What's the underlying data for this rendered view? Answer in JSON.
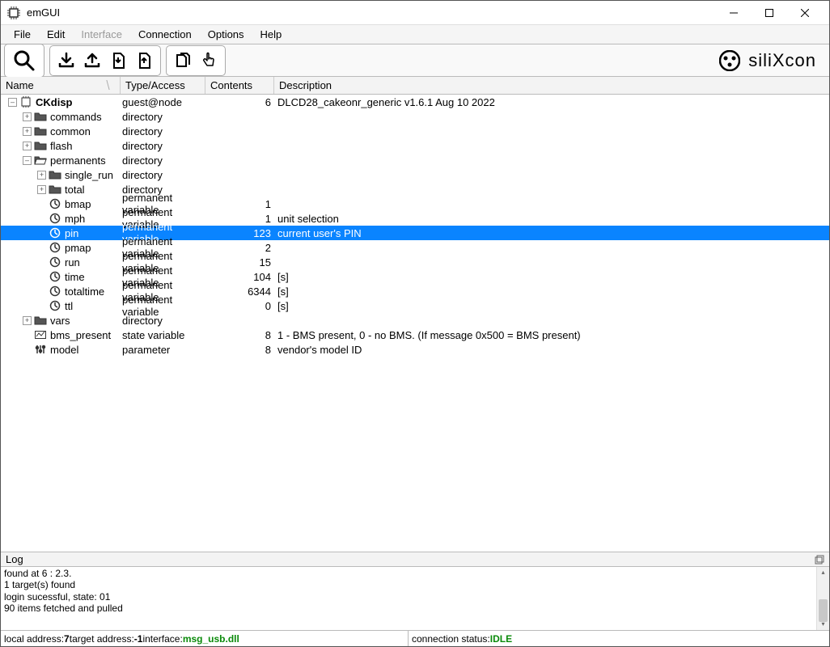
{
  "title": "emGUI",
  "menus": [
    "File",
    "Edit",
    "Interface",
    "Connection",
    "Options",
    "Help"
  ],
  "menus_disabled_index": 2,
  "brand": "siliXcon",
  "columns": {
    "name": "Name",
    "type": "Type/Access",
    "contents": "Contents",
    "desc": "Description"
  },
  "rows": [
    {
      "indent": 0,
      "exp": "-",
      "icon": "chip",
      "label": "CKdisp",
      "bold": true,
      "type": "guest@node",
      "contents": "6",
      "desc": "DLCD28_cakeonr_generic v1.6.1 Aug 10 2022"
    },
    {
      "indent": 1,
      "exp": "+",
      "icon": "folder",
      "label": "commands",
      "type": "directory",
      "contents": "",
      "desc": ""
    },
    {
      "indent": 1,
      "exp": "+",
      "icon": "folder",
      "label": "common",
      "type": "directory",
      "contents": "",
      "desc": ""
    },
    {
      "indent": 1,
      "exp": "+",
      "icon": "folder",
      "label": "flash",
      "type": "directory",
      "contents": "",
      "desc": ""
    },
    {
      "indent": 1,
      "exp": "-",
      "icon": "folder-open",
      "label": "permanents",
      "type": "directory",
      "contents": "",
      "desc": ""
    },
    {
      "indent": 2,
      "exp": "+",
      "icon": "folder",
      "label": "single_run",
      "type": "directory",
      "contents": "",
      "desc": ""
    },
    {
      "indent": 2,
      "exp": "+",
      "icon": "folder",
      "label": "total",
      "type": "directory",
      "contents": "",
      "desc": ""
    },
    {
      "indent": 2,
      "exp": " ",
      "icon": "var",
      "label": "bmap",
      "type": "permanent variable",
      "contents": "1",
      "desc": ""
    },
    {
      "indent": 2,
      "exp": " ",
      "icon": "var",
      "label": "mph",
      "type": "permanent variable",
      "contents": "1",
      "desc": "unit selection"
    },
    {
      "indent": 2,
      "exp": " ",
      "icon": "var",
      "label": "pin",
      "type": "permanent variable",
      "contents": "123",
      "desc": "current user's PIN",
      "selected": true
    },
    {
      "indent": 2,
      "exp": " ",
      "icon": "var",
      "label": "pmap",
      "type": "permanent variable",
      "contents": "2",
      "desc": ""
    },
    {
      "indent": 2,
      "exp": " ",
      "icon": "var",
      "label": "run",
      "type": "permanent variable",
      "contents": "15",
      "desc": ""
    },
    {
      "indent": 2,
      "exp": " ",
      "icon": "var",
      "label": "time",
      "type": "permanent variable",
      "contents": "104",
      "desc": "[s]"
    },
    {
      "indent": 2,
      "exp": " ",
      "icon": "var",
      "label": "totaltime",
      "type": "permanent variable",
      "contents": "6344",
      "desc": "[s]"
    },
    {
      "indent": 2,
      "exp": " ",
      "icon": "var",
      "label": "ttl",
      "type": "permanent variable",
      "contents": "0",
      "desc": "[s]"
    },
    {
      "indent": 1,
      "exp": "+",
      "icon": "folder",
      "label": "vars",
      "type": "directory",
      "contents": "",
      "desc": ""
    },
    {
      "indent": 1,
      "exp": " ",
      "icon": "state",
      "label": "bms_present",
      "type": "state variable",
      "contents": "8",
      "desc": "1 - BMS present, 0 - no BMS. (If message 0x500 = BMS present)"
    },
    {
      "indent": 1,
      "exp": " ",
      "icon": "param",
      "label": "model",
      "type": "parameter",
      "contents": "8",
      "desc": "vendor's model ID"
    }
  ],
  "log_header": "Log",
  "log_lines": [
    "found at 6 : 2.3.",
    "1 target(s) found",
    "login sucessful, state: 01",
    "90 items fetched and pulled"
  ],
  "status": {
    "local_label": "local address: ",
    "local_value": "7",
    "target_label": " target address: ",
    "target_value": "-1",
    "interface_label": " interface: ",
    "interface_value": "msg_usb.dll",
    "conn_label": "connection status: ",
    "conn_value": "IDLE"
  }
}
